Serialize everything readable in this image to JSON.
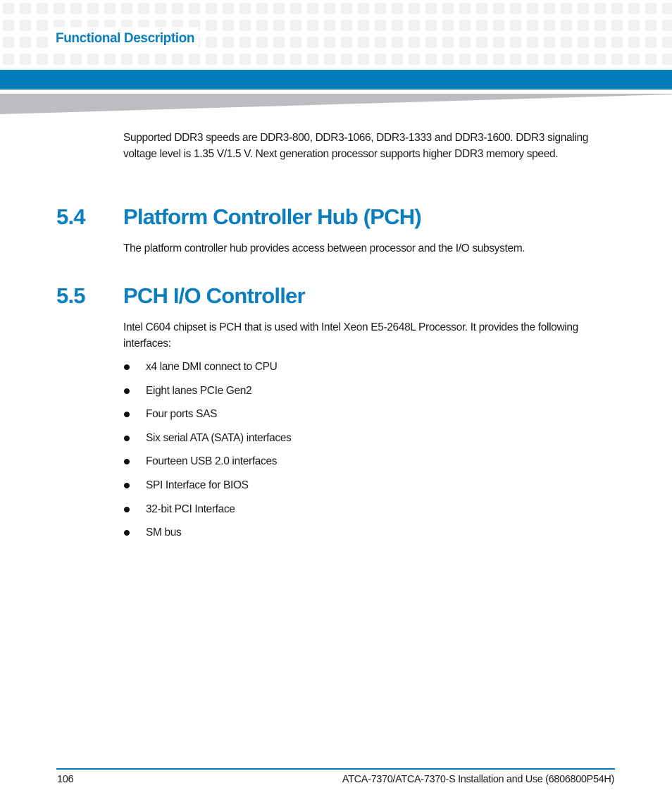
{
  "header": {
    "section_title": "Functional Description",
    "accent_color": "#007cba"
  },
  "intro": {
    "text": "Supported DDR3 speeds are DDR3-800, DDR3-1066, DDR3-1333 and DDR3-1600. DDR3 signaling voltage level is 1.35 V/1.5 V. Next generation processor supports higher DDR3 memory speed."
  },
  "sections": [
    {
      "number": "5.4",
      "title": "Platform Controller Hub (PCH)",
      "body": "The platform controller hub provides access between processor and the I/O subsystem."
    },
    {
      "number": "5.5",
      "title": "PCH I/O Controller",
      "body": "Intel C604 chipset is PCH that is used with Intel Xeon E5-2648L Processor. It provides the following interfaces:",
      "bullets": [
        "x4 lane DMI connect to CPU",
        "Eight lanes PCIe Gen2",
        "Four ports SAS",
        "Six serial ATA (SATA) interfaces",
        "Fourteen USB 2.0 interfaces",
        "SPI Interface for BIOS",
        "32-bit PCI Interface",
        "SM bus"
      ]
    }
  ],
  "footer": {
    "page_number": "106",
    "document_title": "ATCA-7370/ATCA-7370-S Installation and Use (6806800P54H)"
  }
}
